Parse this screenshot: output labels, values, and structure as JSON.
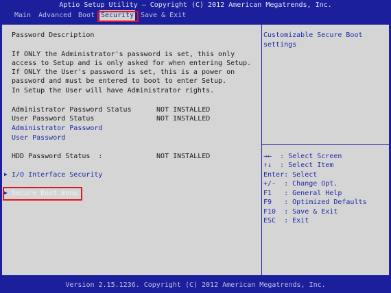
{
  "title": "Aptio Setup Utility – Copyright (C) 2012 American Megatrends, Inc.",
  "tabs": [
    {
      "label": "Main"
    },
    {
      "label": "Advanced"
    },
    {
      "label": "Boot"
    },
    {
      "label": "Security",
      "active": true
    },
    {
      "label": "Save & Exit"
    }
  ],
  "left": {
    "heading": "Password Description",
    "description": [
      "If ONLY the Administrator's password is set, this only",
      "access to Setup and is only asked for when entering Setup.",
      "If ONLY the User's password is set, this is a power on",
      "password and must be entered to boot to enter Setup.",
      "In Setup the User will have Administrator rights."
    ],
    "admin_status_label": "Administrator Password Status",
    "admin_status_value": "NOT INSTALLED",
    "user_status_label": "User Password Status",
    "user_status_value": "NOT INSTALLED",
    "admin_password_link": "Administrator Password",
    "user_password_link": "User Password",
    "hdd_status_label": "HDD Password Status  :",
    "hdd_status_value": "NOT INSTALLED",
    "io_security": "I/O Interface Security",
    "secure_boot_menu": "Secure Boot menu"
  },
  "help": {
    "text": [
      "Customizable Secure Boot",
      "settings"
    ],
    "keys": [
      "→←  : Select Screen",
      "↑↓  : Select Item",
      "Enter: Select",
      "+/-  : Change Opt.",
      "F1   : General Help",
      "F9   : Optimized Defaults",
      "F10  : Save & Exit",
      "ESC  : Exit"
    ]
  },
  "footer": "Version 2.15.1236. Copyright (C) 2012 American Megatrends, Inc."
}
